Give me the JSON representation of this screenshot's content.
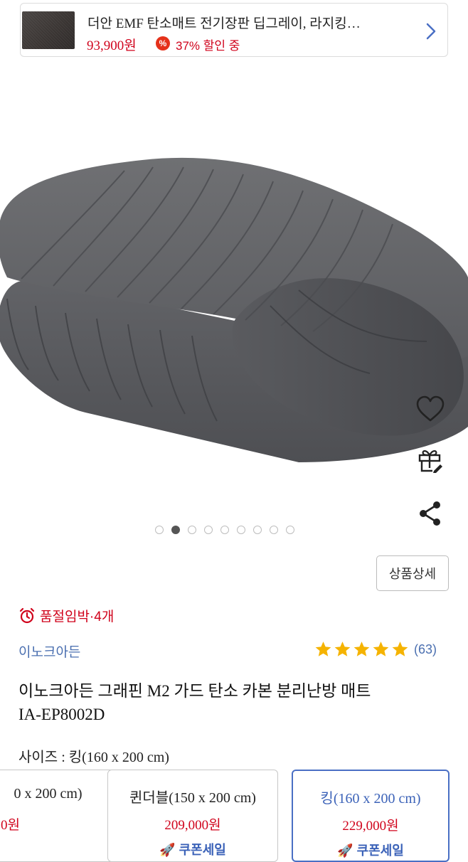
{
  "top_card": {
    "title": "더안 EMF 탄소매트 전기장판 딥그레이, 라지킹…",
    "price": "93,900원",
    "discount_icon": "%",
    "discount_text": "37% 할인 중"
  },
  "gallery": {
    "dot_count": 9,
    "active_index": 1
  },
  "actions": {
    "wishlist_icon": "heart-icon",
    "gift_icon": "gift-icon",
    "share_icon": "share-icon"
  },
  "detail_button": "상품상세",
  "stock_notice": "품절임박·4개",
  "brand": "이노크아든",
  "rating": {
    "stars": 5,
    "count": "(63)"
  },
  "product": {
    "name_line1": "이노크아든 그래핀 M2 가드 탄소 카본 분리난방 매트",
    "name_line2": "IA-EP8002D"
  },
  "size_selection": "사이즈 : 킹(160 x 200 cm)",
  "options": [
    {
      "name": "0 x 200 cm)",
      "price": "0원",
      "coupon": ""
    },
    {
      "name": "퀸더블(150 x 200 cm)",
      "price": "209,000원",
      "coupon": "쿠폰세일"
    },
    {
      "name": "킹(160 x 200 cm)",
      "price": "229,000원",
      "coupon": "쿠폰세일"
    }
  ],
  "colors": {
    "price_red": "#d0021b",
    "link_blue": "#4a6fb0",
    "selected_border": "#4a6fc4",
    "star_gold": "#f5b301"
  }
}
